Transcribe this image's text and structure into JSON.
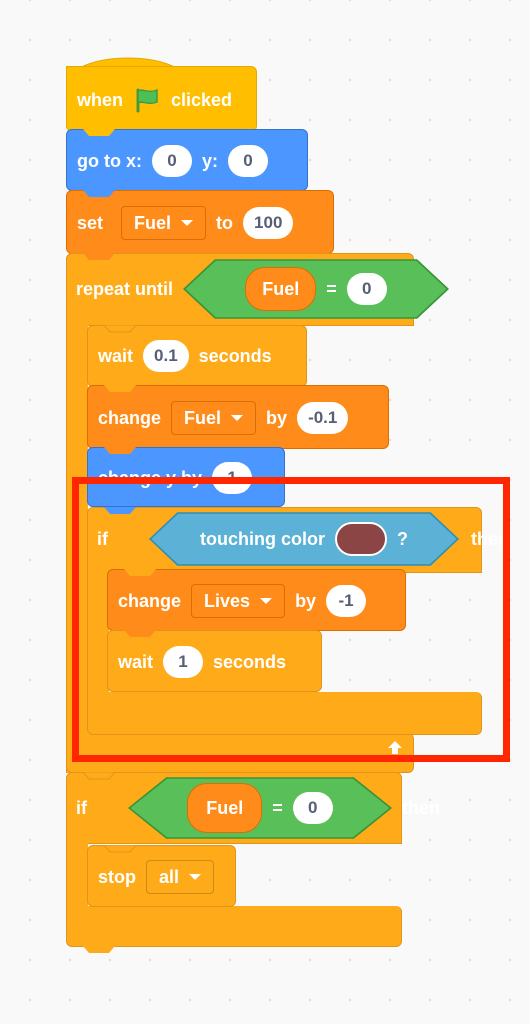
{
  "colors": {
    "events": "#ffbf00",
    "motion": "#4c97ff",
    "variables": "#ff8c1a",
    "control": "#ffab19",
    "operators": "#59c059",
    "sensing": "#5cb1d6",
    "highlight_box": "#ff2600",
    "touching_color_swatch": "#8b4545"
  },
  "script": {
    "hat": {
      "label_before": "when",
      "icon": "green-flag-icon",
      "label_after": "clicked"
    },
    "goto": {
      "label": "go to x:",
      "x_value": "0",
      "y_label": "y:",
      "y_value": "0"
    },
    "set": {
      "label": "set",
      "variable": "Fuel",
      "to_label": "to",
      "value": "100"
    },
    "repeat_until": {
      "label": "repeat until",
      "condition": {
        "left_reporter": "Fuel",
        "operator": "=",
        "right_value": "0"
      },
      "body": {
        "wait": {
          "label": "wait",
          "value": "0.1",
          "unit": "seconds"
        },
        "change_fuel": {
          "label": "change",
          "variable": "Fuel",
          "by_label": "by",
          "value": "-0.1"
        },
        "change_y": {
          "label": "change y by",
          "value": "1"
        },
        "if_touching": {
          "if_label": "if",
          "condition_label": "touching color",
          "condition_suffix": "?",
          "then_label": "then",
          "body": {
            "change_lives": {
              "label": "change",
              "variable": "Lives",
              "by_label": "by",
              "value": "-1"
            },
            "wait": {
              "label": "wait",
              "value": "1",
              "unit": "seconds"
            }
          }
        }
      },
      "loop_icon": "loop-arrow-icon"
    },
    "if_fuel": {
      "if_label": "if",
      "condition": {
        "left_reporter": "Fuel",
        "operator": "=",
        "right_value": "0"
      },
      "then_label": "then",
      "body": {
        "stop": {
          "label": "stop",
          "option": "all"
        }
      }
    }
  }
}
